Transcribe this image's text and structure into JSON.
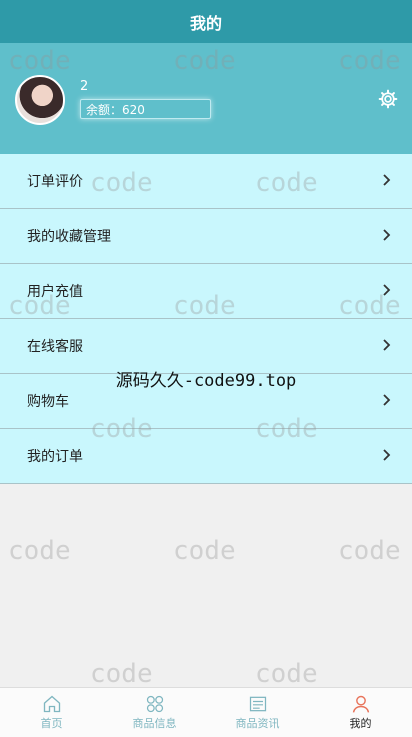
{
  "header": {
    "title": "我的"
  },
  "profile": {
    "username": "2",
    "balance": "余额：620"
  },
  "menu": {
    "items": [
      {
        "label": "订单评价"
      },
      {
        "label": "我的收藏管理"
      },
      {
        "label": "用户充值"
      },
      {
        "label": "在线客服"
      },
      {
        "label": "购物车"
      },
      {
        "label": "我的订单"
      }
    ]
  },
  "tabs": [
    {
      "label": "首页",
      "icon": "home-icon"
    },
    {
      "label": "商品信息",
      "icon": "grid-icon"
    },
    {
      "label": "商品资讯",
      "icon": "news-icon"
    },
    {
      "label": "我的",
      "icon": "user-icon"
    }
  ],
  "watermark": {
    "word": "code",
    "center": "源码久久-code99.top"
  },
  "colors": {
    "topbar": "#2e9aa8",
    "profile": "#5fbfcb",
    "menu_item": "#c9f7fd",
    "active_icon": "#e8735a"
  }
}
